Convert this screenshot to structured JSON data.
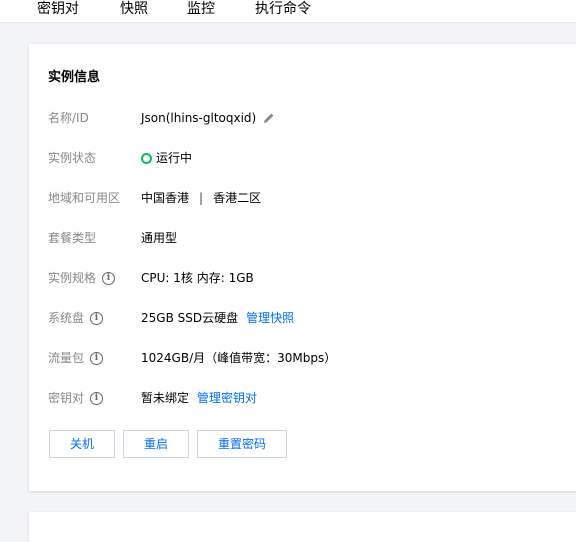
{
  "tabs": [
    {
      "label": "密钥对"
    },
    {
      "label": "快照"
    },
    {
      "label": "监控"
    },
    {
      "label": "执行命令"
    }
  ],
  "card": {
    "title": "实例信息",
    "rows": {
      "name": {
        "label": "名称/ID",
        "value": "Json(lhins-gltoqxid)"
      },
      "status": {
        "label": "实例状态",
        "value": "运行中",
        "color": "#0abf5b"
      },
      "region": {
        "label": "地域和可用区",
        "value": "中国香港",
        "separator": "|",
        "zone": "香港二区"
      },
      "plan": {
        "label": "套餐类型",
        "value": "通用型"
      },
      "spec": {
        "label": "实例规格",
        "value": "CPU: 1核 内存: 1GB"
      },
      "disk": {
        "label": "系统盘",
        "value": "25GB SSD云硬盘",
        "link": "管理快照"
      },
      "traffic": {
        "label": "流量包",
        "value": "1024GB/月（峰值带宽：30Mbps）"
      },
      "keypair": {
        "label": "密钥对",
        "value": "暂未绑定",
        "link": "管理密钥对"
      }
    },
    "buttons": {
      "shutdown": "关机",
      "restart": "重启",
      "reset_password": "重置密码"
    }
  },
  "colors": {
    "link": "#006eff",
    "status_running": "#0abf5b"
  },
  "icons": {
    "edit": "pencil-icon",
    "info": "info-icon",
    "status": "status-dot-icon"
  }
}
